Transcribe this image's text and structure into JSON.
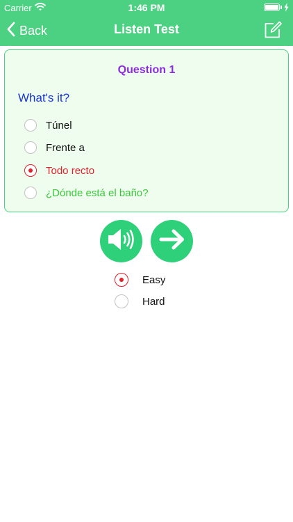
{
  "status_bar": {
    "carrier": "Carrier",
    "time": "1:46 PM"
  },
  "nav": {
    "back_label": "Back",
    "title": "Listen Test",
    "icons": {
      "back": "chevron-left-icon",
      "edit": "compose-icon"
    }
  },
  "question": {
    "title": "Question 1",
    "prompt": "What's it?",
    "options": [
      {
        "label": "Túnel",
        "selected": false,
        "color": "#111111"
      },
      {
        "label": "Frente a",
        "selected": false,
        "color": "#111111"
      },
      {
        "label": "Todo recto",
        "selected": true,
        "color": "#e0202a"
      },
      {
        "label": "¿Dónde está el baño?",
        "selected": false,
        "color": "#3bc73b"
      }
    ]
  },
  "controls": {
    "speaker_icon": "speaker-icon",
    "next_icon": "arrow-right-icon"
  },
  "difficulty": {
    "options": [
      {
        "label": "Easy",
        "selected": true
      },
      {
        "label": "Hard",
        "selected": false
      }
    ]
  },
  "colors": {
    "header": "#4cd182",
    "card_border": "#4cd182",
    "card_background": "#eefdee",
    "question_title": "#8b2be2",
    "prompt": "#1a35d6",
    "selected": "#e0202a",
    "correct": "#3bc73b",
    "button": "#2ed07a"
  }
}
